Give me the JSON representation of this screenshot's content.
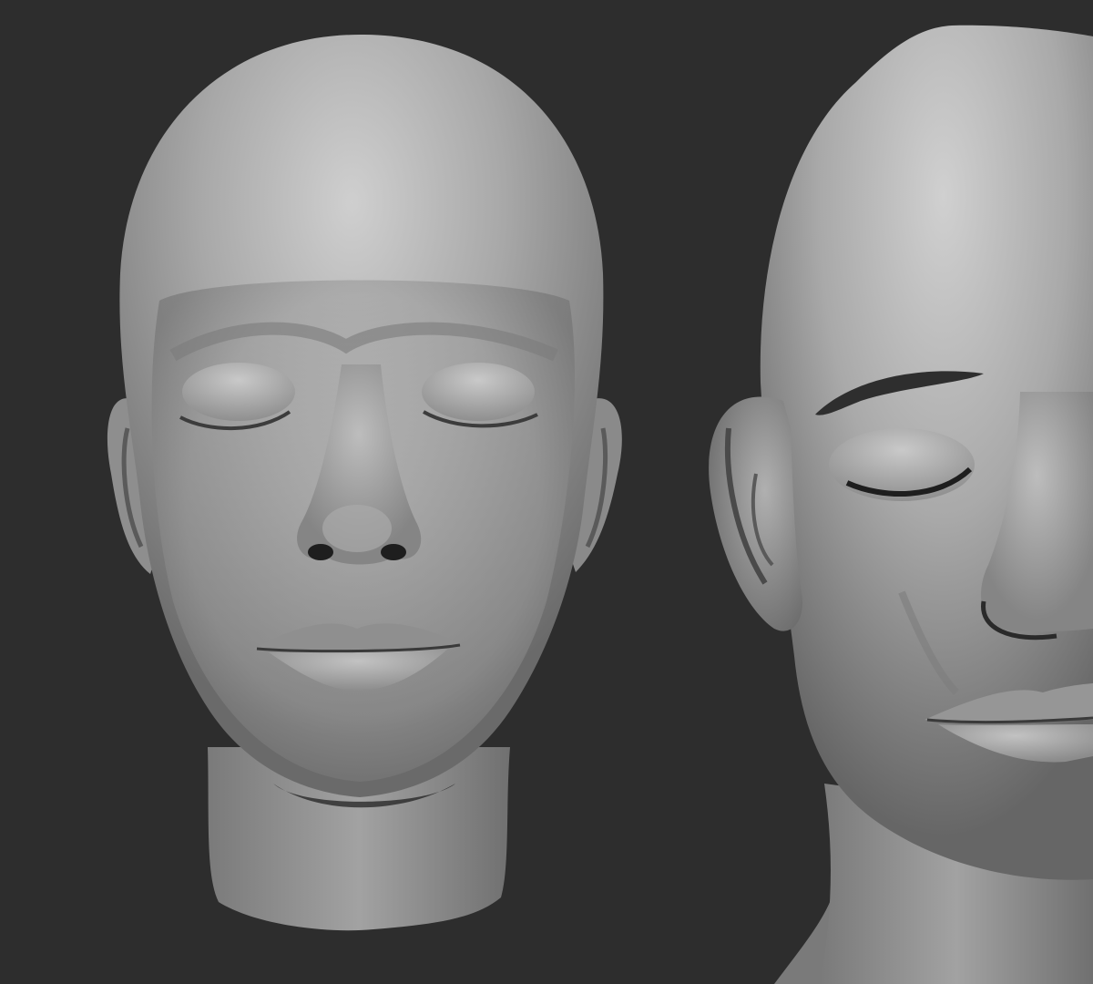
{
  "scene": {
    "background_color": "#2d2d2d",
    "material_light": "#cfcfcf",
    "material_mid": "#9a9a9a",
    "material_dark": "#4a4a4a",
    "sculpts": [
      {
        "label": "",
        "view": "front",
        "eyes": "closed",
        "brows": false
      },
      {
        "label": "",
        "view": "three-quarter",
        "eyes": "closed",
        "brows": true
      }
    ]
  }
}
